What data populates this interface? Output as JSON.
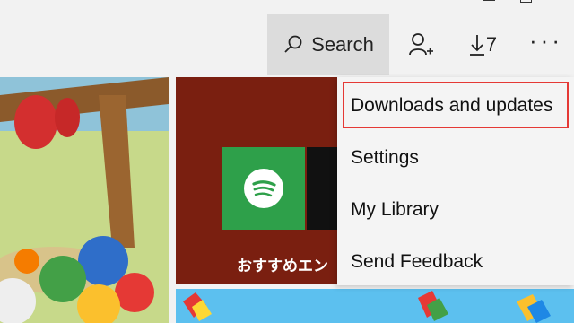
{
  "toolbar": {
    "search_label": "Search",
    "download_count": "7",
    "more_label": "···"
  },
  "promo": {
    "caption": "おすすめエン"
  },
  "menu": {
    "items": [
      {
        "label": "Downloads and updates",
        "highlighted": true
      },
      {
        "label": "Settings"
      },
      {
        "label": "My Library"
      },
      {
        "label": "Send Feedback"
      }
    ]
  },
  "colors": {
    "highlight_border": "#e53935",
    "spotify_green": "#2ea04a"
  }
}
